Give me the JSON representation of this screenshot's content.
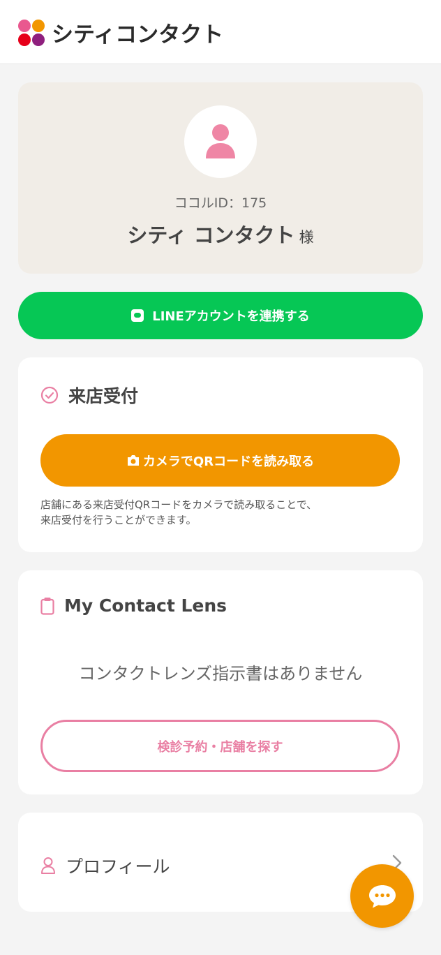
{
  "header": {
    "logo_text": "シティコンタクト",
    "logo_colors": [
      "#e9588f",
      "#f29600",
      "#e6001a",
      "#8f1f7e"
    ]
  },
  "profile": {
    "member_id": "ココルID：175",
    "name": "シティ コンタクト",
    "honorific": "様"
  },
  "line_button": {
    "label": "LINEアカウントを連携する",
    "color": "#06c755"
  },
  "visit": {
    "title": "来店受付",
    "qr_button_label": "カメラでQRコードを読み取る",
    "description_line1": "店舗にある来店受付QRコードをカメラで読み取ることで、",
    "description_line2": "来店受付を行うことができます。"
  },
  "lens": {
    "title": "My Contact Lens",
    "empty_message": "コンタクトレンズ指示書はありません",
    "search_button_label": "検診予約・店舗を探す"
  },
  "profile_link": {
    "label": "プロフィール"
  },
  "colors": {
    "accent_pink": "#e97fa3",
    "accent_orange": "#f29600"
  },
  "icons": {
    "avatar": "user-icon",
    "visit": "check-circle-icon",
    "camera": "camera-icon",
    "lens": "clipboard-icon",
    "profile": "user-outline-icon",
    "chevron": "chevron-right-icon",
    "chat": "chat-bubble-icon"
  }
}
